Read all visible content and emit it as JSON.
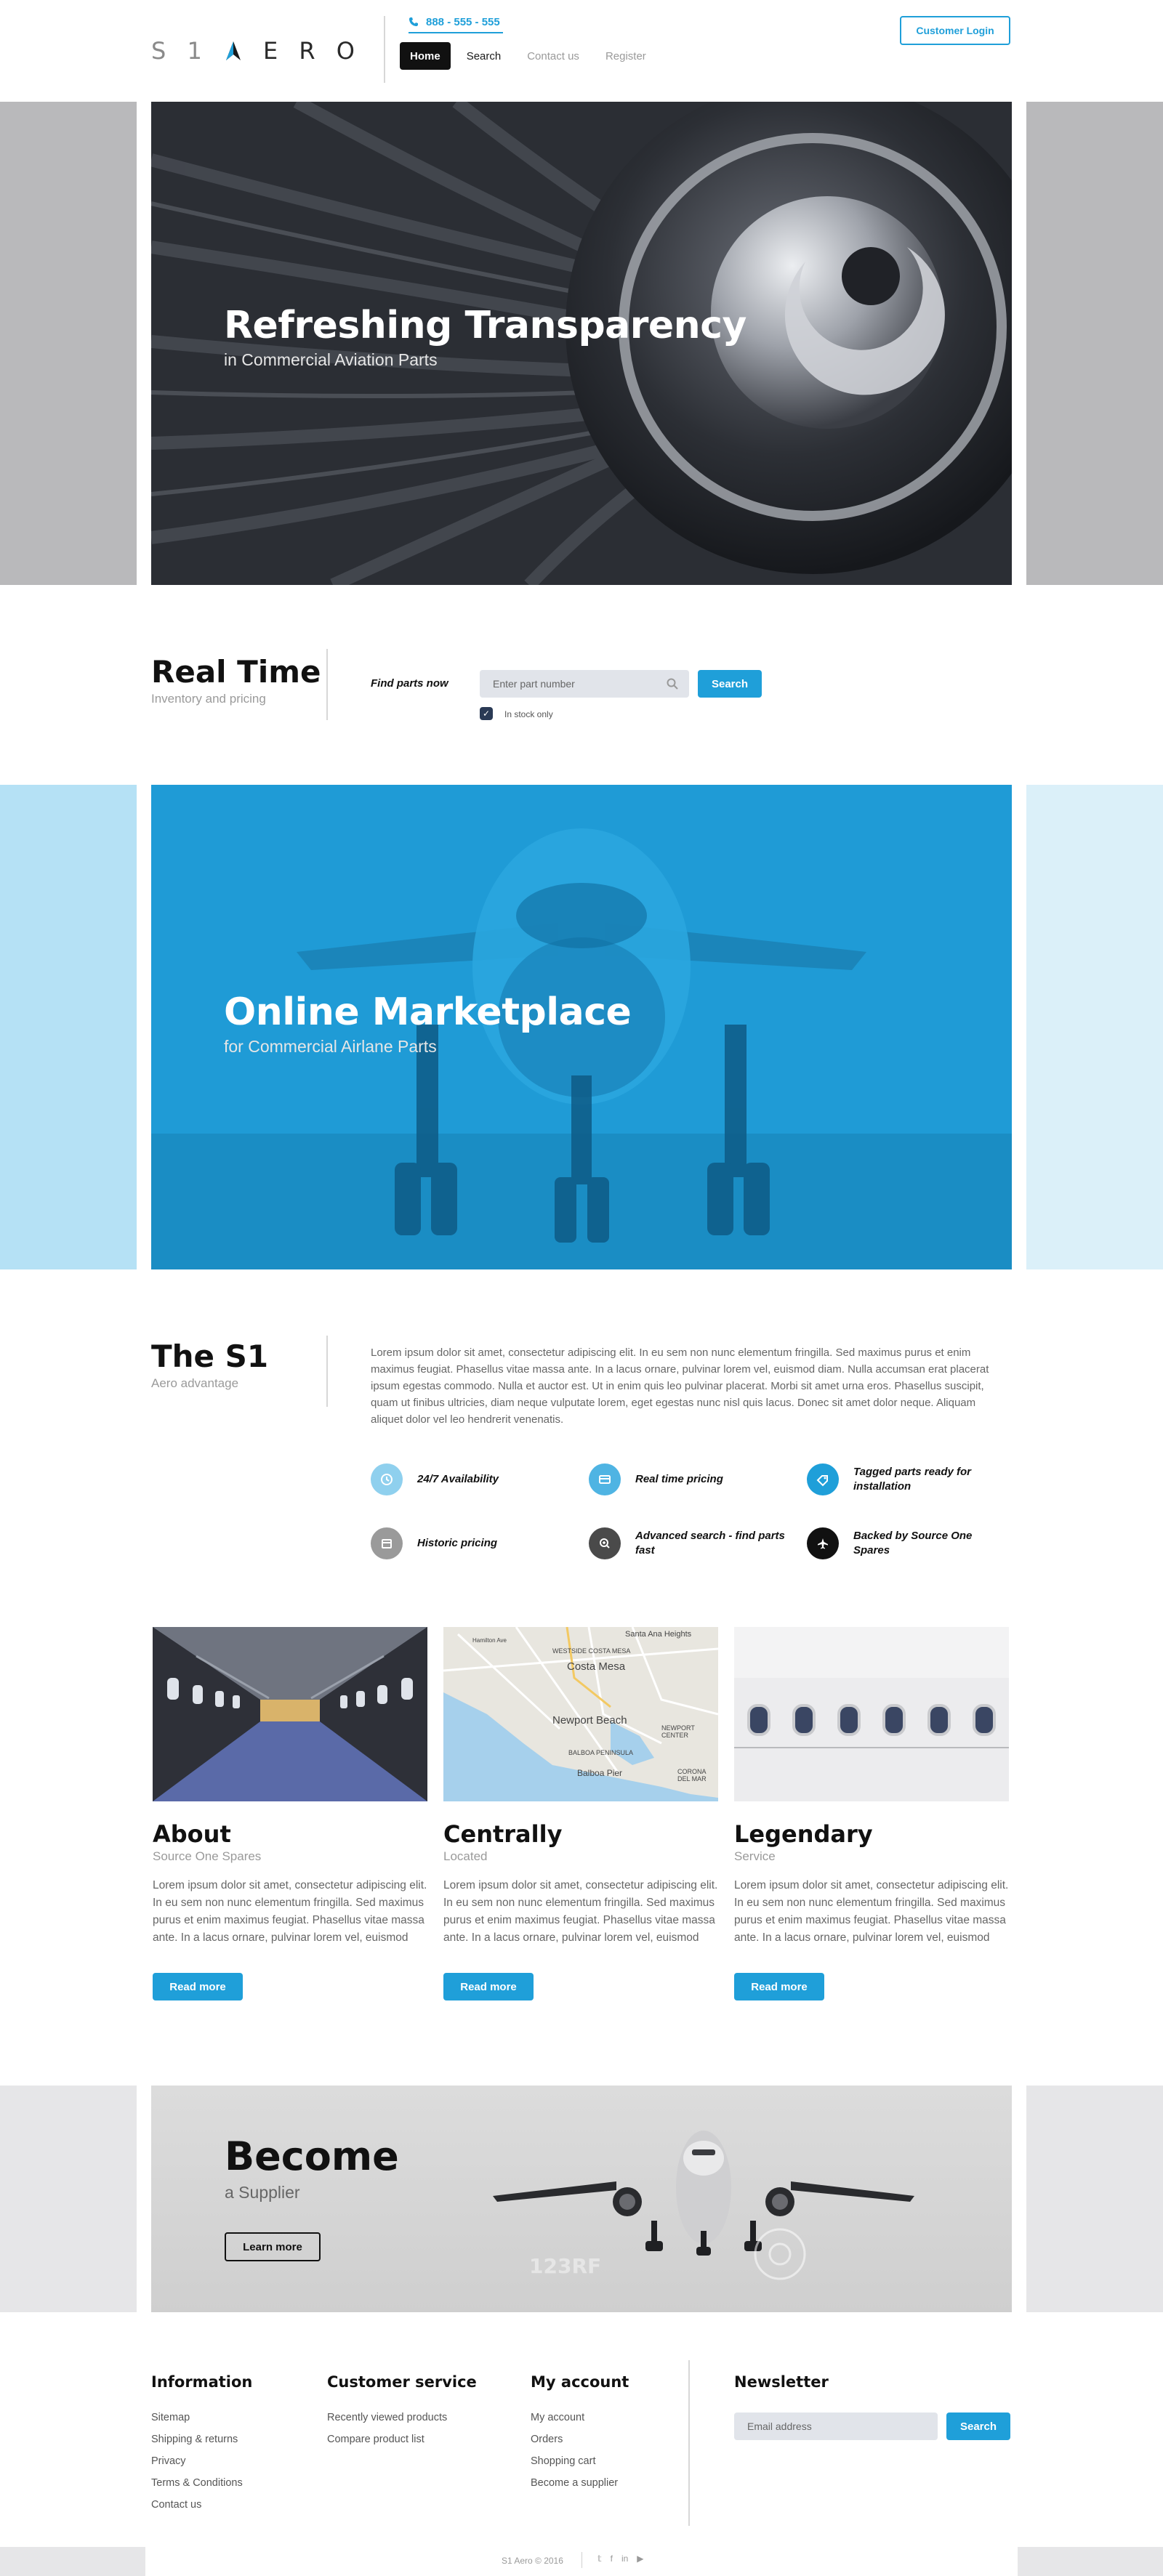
{
  "header": {
    "logo": {
      "s": "S",
      "one": "1",
      "a": "A",
      "e": "E",
      "r": "R",
      "o": "O"
    },
    "phone": "888 - 555 - 555",
    "nav": [
      "Home",
      "Search",
      "Contact us",
      "Register"
    ],
    "login": "Customer Login"
  },
  "hero1": {
    "title": "Refreshing Transparency",
    "subtitle": "in Commercial Aviation Parts"
  },
  "realtime": {
    "title": "Real Time",
    "subtitle": "Inventory and pricing",
    "find_label": "Find parts now",
    "search_placeholder": "Enter part number",
    "search_button": "Search",
    "in_stock_label": "In stock only"
  },
  "hero2": {
    "title": "Online Marketplace",
    "subtitle": "for Commercial Airlane Parts"
  },
  "s1": {
    "title": "The S1",
    "subtitle": "Aero advantage",
    "paragraph": "Lorem ipsum dolor sit amet, consectetur adipiscing elit. In eu sem non nunc elementum fringilla. Sed maximus purus et enim maximus feugiat. Phasellus vitae massa ante. In a lacus ornare, pulvinar lorem vel, euismod diam. Nulla accumsan erat placerat ipsum egestas commodo. Nulla et auctor est. Ut in enim quis leo pulvinar placerat. Morbi sit amet urna eros. Phasellus suscipit, quam ut finibus ultricies, diam neque vulputate lorem, eget egestas nunc nisl quis lacus. Donec sit amet dolor neque. Aliquam aliquet dolor vel leo hendrerit venenatis.",
    "features": [
      {
        "label": "24/7 Availability",
        "icon": "clock-icon",
        "color": "#8fd0ee"
      },
      {
        "label": "Real time pricing",
        "icon": "credit-card-icon",
        "color": "#4fb4e3"
      },
      {
        "label": "Tagged parts ready for installation",
        "icon": "tag-icon",
        "color": "#1f9fd9"
      },
      {
        "label": "Historic pricing",
        "icon": "calendar-icon",
        "color": "#9a9a9a"
      },
      {
        "label": "Advanced search - find parts fast",
        "icon": "zoom-in-icon",
        "color": "#4a4a4a"
      },
      {
        "label": "Backed by Source One Spares",
        "icon": "airplane-icon",
        "color": "#111111"
      }
    ]
  },
  "map": {
    "labels": [
      "Santa Ana Heights",
      "WESTSIDE COSTA MESA",
      "Costa Mesa",
      "Newport Beach",
      "NEWPORT CENTER",
      "BALBOA PENINSULA",
      "Balboa Pier",
      "CORONA DEL MAR",
      "Hamilton Ave"
    ]
  },
  "cards": [
    {
      "title": "About",
      "subtitle": "Source One Spares",
      "text": "Lorem ipsum dolor sit amet, consectetur adipiscing elit. In eu sem non nunc elementum fringilla. Sed maximus purus et enim maximus feugiat. Phasellus vitae massa ante. In a lacus ornare, pulvinar lorem vel, euismod diam. Nulla accumsan erat placerat ipsum",
      "button": "Read more"
    },
    {
      "title": "Centrally",
      "subtitle": "Located",
      "text": "Lorem ipsum dolor sit amet, consectetur adipiscing elit. In eu sem non nunc elementum fringilla. Sed maximus purus et enim maximus feugiat. Phasellus vitae massa ante. In a lacus ornare, pulvinar lorem vel, euismod diam. Nulla accumsan erat placerat ipsum",
      "button": "Read more"
    },
    {
      "title": "Legendary",
      "subtitle": "Service",
      "text": "Lorem ipsum dolor sit amet, consectetur adipiscing elit. In eu sem non nunc elementum fringilla. Sed maximus purus et enim maximus feugiat. Phasellus vitae massa ante. In a lacus ornare, pulvinar lorem vel, euismod diam. Nulla accumsan erat placerat ipsum",
      "button": "Read more"
    }
  ],
  "become": {
    "title": "Become",
    "subtitle": "a Supplier",
    "button": "Learn more",
    "watermark": "123RF"
  },
  "footer": {
    "columns": [
      {
        "heading": "Information",
        "links": [
          "Sitemap",
          "Shipping & returns",
          "Privacy",
          "Terms & Conditions",
          "Contact us"
        ]
      },
      {
        "heading": "Customer service",
        "links": [
          "Recently viewed products",
          "Compare product list"
        ]
      },
      {
        "heading": "My account",
        "links": [
          "My account",
          "Orders",
          "Shopping cart",
          "Become a supplier"
        ]
      }
    ],
    "newsletter": {
      "heading": "Newsletter",
      "placeholder": "Email address",
      "button": "Search"
    },
    "copyright": "S1 Aero © 2016",
    "social": [
      "twitter-icon",
      "facebook-icon",
      "linkedin-icon",
      "youtube-icon"
    ]
  },
  "colors": {
    "accent": "#1f9fd9",
    "dark": "#111111",
    "muted": "#9a9a9a"
  }
}
